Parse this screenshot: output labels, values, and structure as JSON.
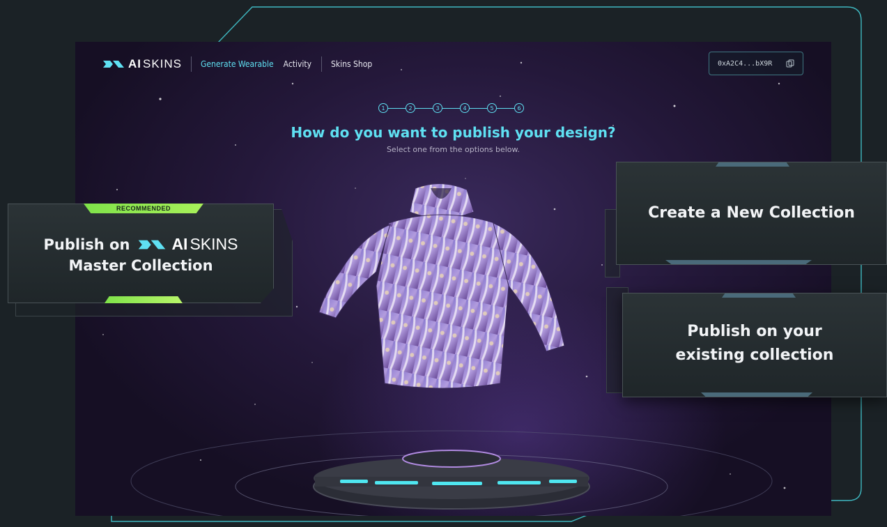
{
  "brand": {
    "ai": "AI",
    "skins": "SKINS"
  },
  "nav": {
    "links": [
      "Generate Wearable",
      "Activity",
      "Skins Shop"
    ],
    "active_index": 0
  },
  "wallet": {
    "address": "0xA2C4...bX9R",
    "copy_icon": "copy-icon"
  },
  "stepper": {
    "steps": [
      "1",
      "2",
      "3",
      "4",
      "5",
      "6"
    ]
  },
  "main": {
    "heading": "How do you want to publish your design?",
    "subheading": "Select one from the options below."
  },
  "options": {
    "master": {
      "badge": "RECOMMENDED",
      "prefix": "Publish on",
      "line2": "Master Collection"
    },
    "new_collection": {
      "label": "Create a New Collection"
    },
    "existing": {
      "line1": "Publish on your",
      "line2": "existing collection"
    }
  },
  "colors": {
    "accent": "#5fe0f2",
    "recommended": "#8fe84f",
    "background": "#1b2226",
    "card": "#262e31"
  }
}
